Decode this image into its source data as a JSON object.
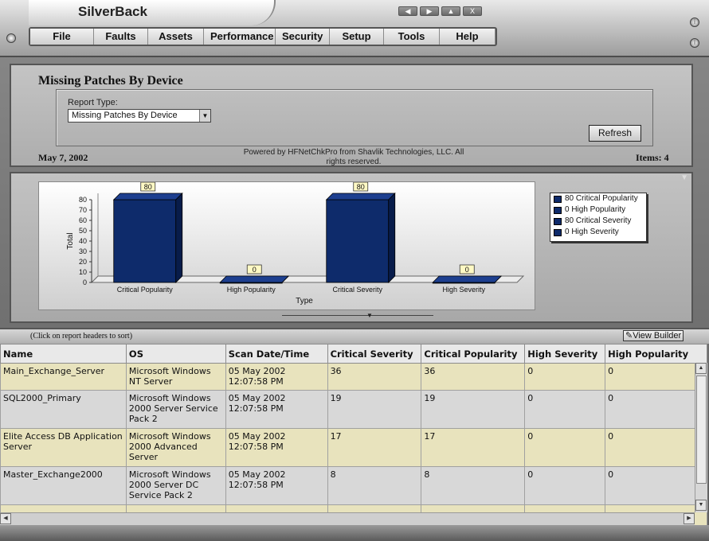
{
  "app": {
    "title": "SilverBack",
    "window_controls": [
      "◀",
      "▶",
      "▲",
      "X"
    ]
  },
  "menu": {
    "items": [
      "File",
      "Faults",
      "Assets",
      "Performance",
      "Security",
      "Setup",
      "Tools",
      "Help"
    ]
  },
  "report": {
    "title": "Missing Patches By Device",
    "type_label": "Report Type:",
    "type_value": "Missing Patches By Device",
    "refresh_label": "Refresh",
    "date": "May 7, 2002",
    "powered_by": "Powered by HFNetChkPro from Shavlik Technologies, LLC. All rights reserved.",
    "items": "Items: 4"
  },
  "chart_data": {
    "type": "bar",
    "categories": [
      "Critical Popularity",
      "High Popularity",
      "Critical Severity",
      "High Severity"
    ],
    "values": [
      80,
      0,
      80,
      0
    ],
    "data_labels": [
      "80",
      "0",
      "80",
      "0"
    ],
    "title": "",
    "xlabel": "Type",
    "ylabel": "Total",
    "ylim": [
      0,
      80
    ],
    "yticks": [
      "0",
      "10",
      "20",
      "30",
      "40",
      "50",
      "60",
      "70",
      "80"
    ],
    "grid": false,
    "bar_color": "#0e2b6b",
    "legend": [
      "80 Critical Popularity",
      "0 High Popularity",
      "80 Critical Severity",
      "0 High Severity"
    ],
    "legend_position": "right"
  },
  "grid": {
    "hint": "(Click on report headers to sort)",
    "view_builder": "View Builder",
    "columns": [
      "Name",
      "OS",
      "Scan Date/Time",
      "Critical Severity",
      "Critical Popularity",
      "High Severity",
      "High Popularity"
    ],
    "rows": [
      {
        "name": "Main_Exchange_Server",
        "os": "Microsoft Windows NT Server",
        "scan": "05 May 2002 12:07:58 PM",
        "crit_sev": "36",
        "crit_pop": "36",
        "high_sev": "0",
        "high_pop": "0"
      },
      {
        "name": "SQL2000_Primary",
        "os": "Microsoft Windows 2000 Server Service Pack 2",
        "scan": "05 May 2002 12:07:58 PM",
        "crit_sev": "19",
        "crit_pop": "19",
        "high_sev": "0",
        "high_pop": "0"
      },
      {
        "name": "Elite Access DB Application Server",
        "os": "Microsoft Windows 2000 Advanced Server",
        "scan": "05 May 2002 12:07:58 PM",
        "crit_sev": "17",
        "crit_pop": "17",
        "high_sev": "0",
        "high_pop": "0"
      },
      {
        "name": "Master_Exchange2000",
        "os": "Microsoft Windows 2000 Server DC Service Pack 2",
        "scan": "05 May 2002 12:07:58 PM",
        "crit_sev": "8",
        "crit_pop": "8",
        "high_sev": "0",
        "high_pop": "0"
      }
    ]
  }
}
